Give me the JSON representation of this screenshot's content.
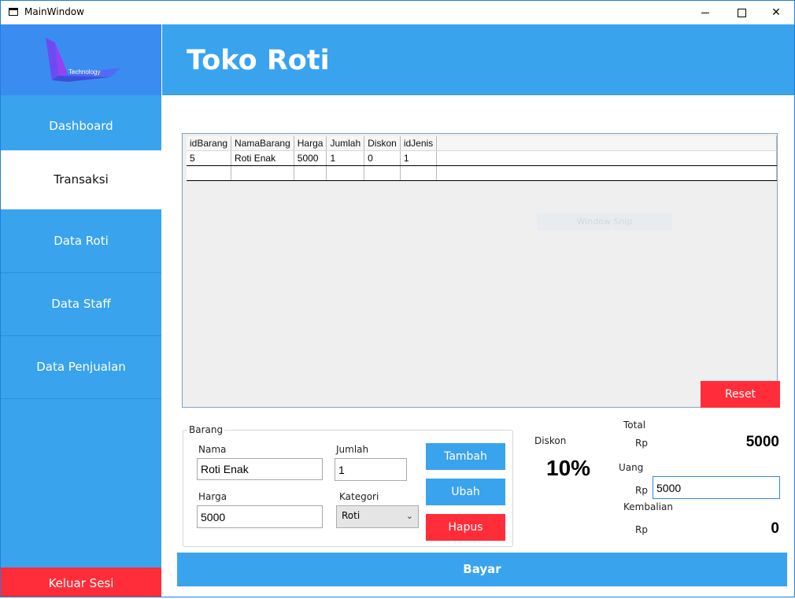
{
  "window": {
    "title": "MainWindow"
  },
  "logo": {
    "text": "Technology"
  },
  "sidebar": {
    "items": [
      {
        "label": "Dashboard"
      },
      {
        "label": "Transaksi"
      },
      {
        "label": "Data Roti"
      },
      {
        "label": "Data Staff"
      },
      {
        "label": "Data Penjualan"
      }
    ],
    "active_index": 1,
    "logout_label": "Keluar Sesi"
  },
  "header": {
    "title": "Toko Roti"
  },
  "grid": {
    "columns": [
      "idBarang",
      "NamaBarang",
      "Harga",
      "Jumlah",
      "Diskon",
      "idJenis"
    ],
    "rows": [
      [
        "5",
        "Roti Enak",
        "5000",
        "1",
        "0",
        "1"
      ]
    ],
    "overlay_text": "Window Snip"
  },
  "reset_label": "Reset",
  "form": {
    "group_label": "Barang",
    "nama_label": "Nama",
    "nama_value": "Roti Enak",
    "jumlah_label": "Jumlah",
    "jumlah_value": "1",
    "harga_label": "Harga",
    "harga_value": "5000",
    "kategori_label": "Kategori",
    "kategori_value": "Roti"
  },
  "actions": {
    "tambah": "Tambah",
    "ubah": "Ubah",
    "hapus": "Hapus"
  },
  "diskon": {
    "label": "Diskon",
    "value": "10%"
  },
  "summary": {
    "total_label": "Total",
    "total_currency": "Rp",
    "total_value": "5000",
    "uang_label": "Uang",
    "uang_currency": "Rp",
    "uang_value": "5000",
    "kembalian_label": "Kembalian",
    "kembalian_currency": "Rp",
    "kembalian_value": "0"
  },
  "bayar_label": "Bayar",
  "colors": {
    "accent_blue": "#3aa3ee",
    "logo_blue": "#3b8cf0",
    "danger_red": "#ff2d3a"
  }
}
